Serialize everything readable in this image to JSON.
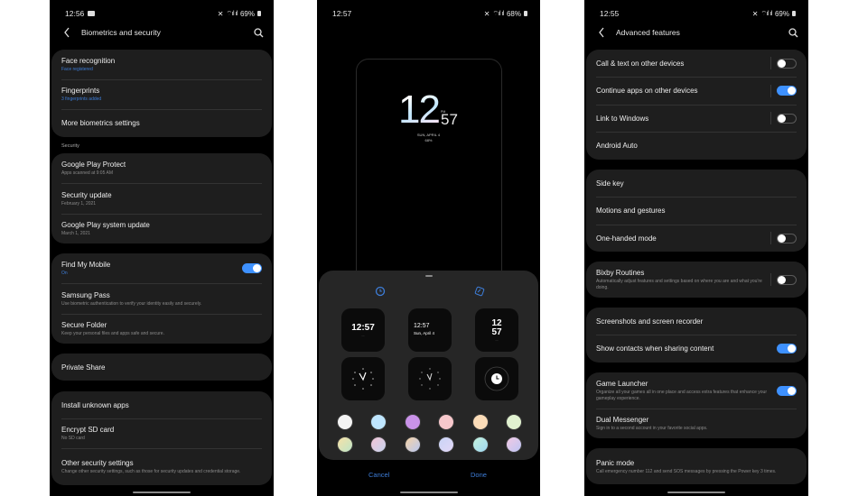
{
  "panel1": {
    "status": {
      "time": "12:56",
      "battery": "69%"
    },
    "title": "Biometrics and security",
    "groups": [
      {
        "items": [
          {
            "label": "Face recognition",
            "sub": "Face registered",
            "sub_color": "blue"
          },
          {
            "label": "Fingerprints",
            "sub": "3 fingerprints added",
            "sub_color": "blue"
          },
          {
            "label": "More biometrics settings"
          }
        ]
      },
      {
        "section": "Security",
        "items": [
          {
            "label": "Google Play Protect",
            "sub": "Apps scanned at 9:05 AM"
          },
          {
            "label": "Security update",
            "sub": "February 1, 2021"
          },
          {
            "label": "Google Play system update",
            "sub": "March 1, 2021"
          }
        ]
      },
      {
        "items": [
          {
            "label": "Find My Mobile",
            "sub": "On",
            "sub_color": "blue",
            "toggle": true
          },
          {
            "label": "Samsung Pass",
            "sub": "Use biometric authentication to verify your identity easily and securely."
          },
          {
            "label": "Secure Folder",
            "sub": "Keep your personal files and apps safe and secure."
          }
        ]
      },
      {
        "items": [
          {
            "label": "Private Share"
          }
        ]
      },
      {
        "items": [
          {
            "label": "Install unknown apps"
          },
          {
            "label": "Encrypt SD card",
            "sub": "No SD card"
          },
          {
            "label": "Other security settings",
            "sub": "Change other security settings, such as those for security updates and credential storage."
          }
        ]
      }
    ]
  },
  "panel2": {
    "status": {
      "time": "12:57",
      "battery": "68%"
    },
    "lock_clock": {
      "hour": "12",
      "minute": "57",
      "ampm": "PM",
      "date": "SUN, APRIL 4",
      "battery": "68%"
    },
    "faces": [
      {
        "type": "digital",
        "time": "12:57",
        "style": "bold"
      },
      {
        "type": "digital",
        "time": "12:57",
        "date": "Sun, April 4",
        "style": "left"
      },
      {
        "type": "stacked",
        "hour": "12",
        "minute": "57"
      },
      {
        "type": "analog",
        "style": "numerals"
      },
      {
        "type": "analog",
        "style": "dots"
      },
      {
        "type": "circle",
        "style": "minimal"
      }
    ],
    "swatches": [
      "#f4f4f4",
      "#bfe6ff",
      "#c992e8",
      "#f7c8cc",
      "#fbdcb8",
      "#e1f2d0",
      "gradient-1",
      "gradient-2",
      "gradient-3",
      "gradient-4",
      "gradient-5",
      "gradient-6"
    ],
    "cancel_label": "Cancel",
    "done_label": "Done",
    "accent": "#3d7dd8"
  },
  "panel3": {
    "status": {
      "time": "12:55",
      "battery": "69%"
    },
    "title": "Advanced features",
    "groups": [
      {
        "items": [
          {
            "label": "Call & text on other devices",
            "toggle": false
          },
          {
            "label": "Continue apps on other devices",
            "toggle": true
          },
          {
            "label": "Link to Windows",
            "toggle": false
          },
          {
            "label": "Android Auto"
          }
        ]
      },
      {
        "items": [
          {
            "label": "Side key"
          },
          {
            "label": "Motions and gestures"
          },
          {
            "label": "One-handed mode",
            "toggle": false
          }
        ]
      },
      {
        "items": [
          {
            "label": "Bixby Routines",
            "sub": "Automatically adjust features and settings based on where you are and what you're doing.",
            "toggle": false
          }
        ]
      },
      {
        "items": [
          {
            "label": "Screenshots and screen recorder"
          },
          {
            "label": "Show contacts when sharing content",
            "toggle": true
          }
        ]
      },
      {
        "items": [
          {
            "label": "Game Launcher",
            "sub": "Organize all your games all in one place and access extra features that enhance your gameplay experience.",
            "toggle": true
          },
          {
            "label": "Dual Messenger",
            "sub": "Sign in to a second account in your favorite social apps."
          }
        ]
      },
      {
        "items": [
          {
            "label": "Panic mode",
            "sub": "Call emergency number 112 and send SOS messages by pressing the Power key 3 times."
          }
        ]
      }
    ]
  },
  "colors": {
    "toggle_on": "#3e91ff",
    "link_blue": "#3d7dd8",
    "card_bg": "#1e1e1e"
  }
}
